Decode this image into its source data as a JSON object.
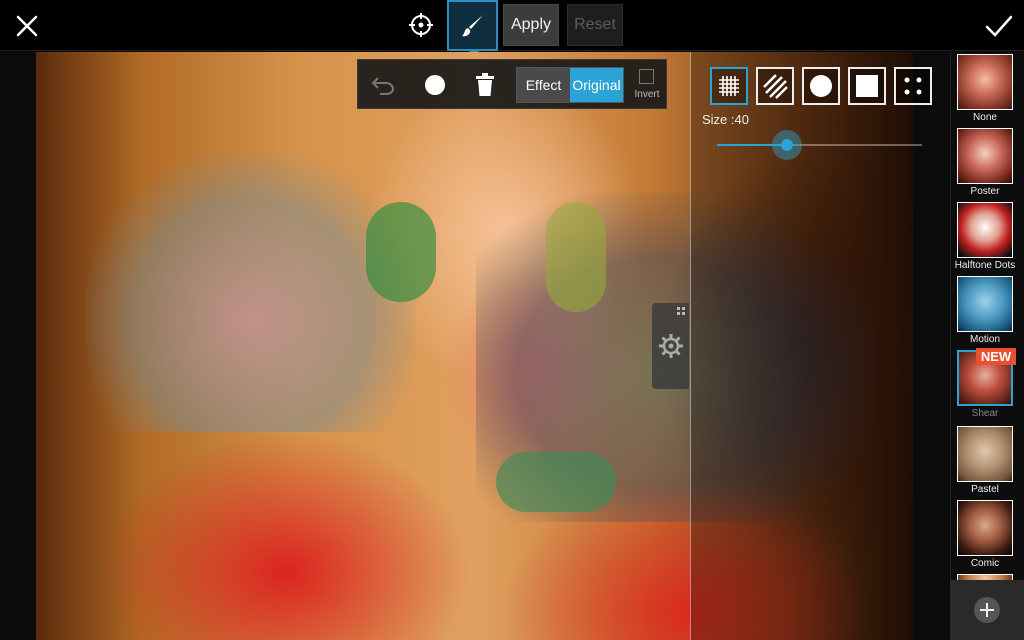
{
  "toolbar": {
    "close_icon": "close-icon",
    "target_icon": "crosshair-icon",
    "brush_icon": "brush-icon",
    "apply_label": "Apply",
    "reset_label": "Reset",
    "confirm_icon": "checkmark-icon"
  },
  "brush_panel": {
    "undo_icon": "undo-icon",
    "brush_dot_icon": "brush-dot-icon",
    "trash_icon": "trash-icon",
    "effect_label": "Effect",
    "original_label": "Original",
    "selected_mode": "Original",
    "invert_label": "Invert",
    "invert_checked": false
  },
  "brush_shapes": {
    "items": [
      "grid-brush-icon",
      "stripe-brush-icon",
      "circle-brush-icon",
      "square-brush-icon",
      "dots-brush-icon"
    ],
    "selected": 0
  },
  "size": {
    "label": "Size :40",
    "value_fraction": 0.34
  },
  "effects": {
    "items": [
      {
        "name": "None"
      },
      {
        "name": "Poster"
      },
      {
        "name": "Halftone Dots"
      },
      {
        "name": "Motion"
      },
      {
        "name": "Shear",
        "badge": "NEW"
      },
      {
        "name": "Pastel"
      },
      {
        "name": "Comic"
      }
    ],
    "selected": "Shear"
  },
  "add_icon": "plus-icon",
  "colors": {
    "accent": "#2ba3d6",
    "badge": "#e9502f"
  }
}
